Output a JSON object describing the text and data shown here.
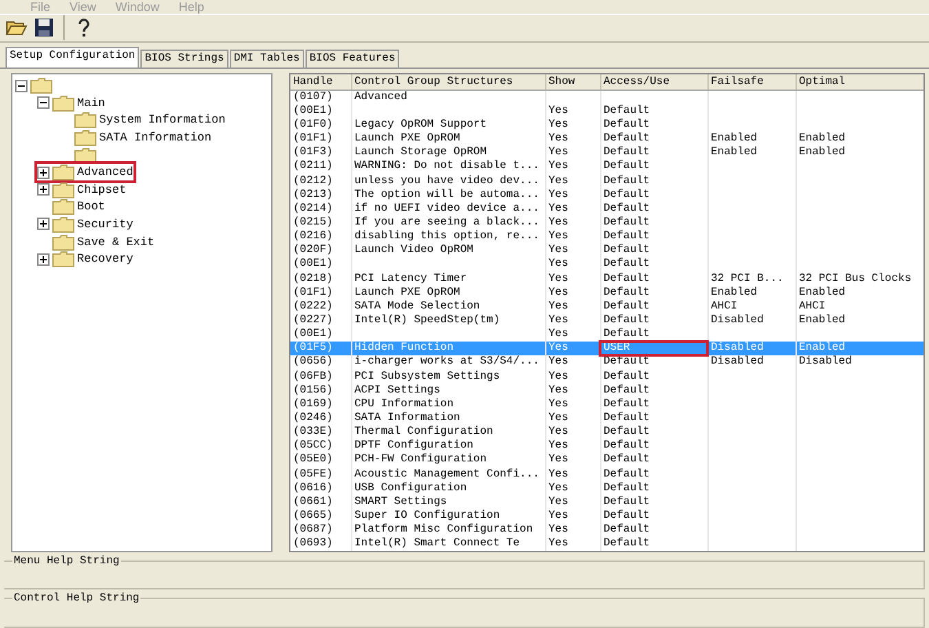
{
  "menu": [
    "File",
    "View",
    "Window",
    "Help"
  ],
  "tabs": [
    {
      "label": "Setup Configuration",
      "selected": true
    },
    {
      "label": "BIOS Strings",
      "selected": false
    },
    {
      "label": "DMI Tables",
      "selected": false
    },
    {
      "label": "BIOS Features",
      "selected": false
    }
  ],
  "tree": [
    {
      "kind": "branch",
      "expanded": true,
      "marked": false,
      "children": [
        {
          "kind": "branch",
          "label": "Main",
          "expanded": true,
          "marked": false,
          "children": [
            {
              "kind": "leaf",
              "label": "System Information",
              "marked": false
            },
            {
              "kind": "leaf",
              "label": "SATA Information",
              "marked": false
            },
            {
              "kind": "leaf",
              "marked": false
            }
          ]
        },
        {
          "kind": "branch",
          "label": "Advanced",
          "expanded": false,
          "marked": true
        },
        {
          "kind": "branch",
          "label": "Chipset",
          "expanded": false,
          "marked": false
        },
        {
          "kind": "leaf",
          "label": "Boot",
          "marked": false
        },
        {
          "kind": "branch",
          "label": "Security",
          "expanded": false,
          "marked": false
        },
        {
          "kind": "leaf",
          "label": "Save & Exit",
          "marked": false
        },
        {
          "kind": "branch",
          "label": "Recovery",
          "expanded": false,
          "marked": false
        }
      ]
    }
  ],
  "table": {
    "columns": [
      "Handle",
      "Control Group Structures",
      "Show",
      "Access/Use",
      "Failsafe",
      "Optimal"
    ],
    "rows": [
      {
        "handle": "(0107)",
        "structure": "Advanced",
        "selected": false,
        "access_marked": false
      },
      {
        "handle": "(00E1)",
        "show": "Yes",
        "access": "Default",
        "selected": false,
        "access_marked": false
      },
      {
        "handle": "(01F0)",
        "structure": "Legacy OpROM Support",
        "show": "Yes",
        "access": "Default",
        "selected": false,
        "access_marked": false
      },
      {
        "handle": "(01F1)",
        "structure": "Launch PXE OpROM",
        "show": "Yes",
        "access": "Default",
        "failsafe": "Enabled",
        "optimal": "Enabled",
        "selected": false,
        "access_marked": false
      },
      {
        "handle": "(01F3)",
        "structure": "Launch Storage OpROM",
        "show": "Yes",
        "access": "Default",
        "failsafe": "Enabled",
        "optimal": "Enabled",
        "selected": false,
        "access_marked": false
      },
      {
        "handle": "(0211)",
        "structure": "WARNING: Do not disable t...",
        "show": "Yes",
        "access": "Default",
        "selected": false,
        "access_marked": false
      },
      {
        "handle": "(0212)",
        "structure": "unless you have video dev...",
        "show": "Yes",
        "access": "Default",
        "selected": false,
        "access_marked": false
      },
      {
        "handle": "(0213)",
        "structure": "The option will be automa...",
        "show": "Yes",
        "access": "Default",
        "selected": false,
        "access_marked": false
      },
      {
        "handle": "(0214)",
        "structure": "if no UEFI video device a...",
        "show": "Yes",
        "access": "Default",
        "selected": false,
        "access_marked": false
      },
      {
        "handle": "(0215)",
        "structure": "If you are seeing a black...",
        "show": "Yes",
        "access": "Default",
        "selected": false,
        "access_marked": false
      },
      {
        "handle": "(0216)",
        "structure": "disabling this option, re...",
        "show": "Yes",
        "access": "Default",
        "selected": false,
        "access_marked": false
      },
      {
        "handle": "(020F)",
        "structure": "Launch Video OpROM",
        "show": "Yes",
        "access": "Default",
        "selected": false,
        "access_marked": false
      },
      {
        "handle": "(00E1)",
        "show": "Yes",
        "access": "Default",
        "selected": false,
        "access_marked": false
      },
      {
        "handle": "(0218)",
        "structure": "PCI Latency Timer",
        "show": "Yes",
        "access": "Default",
        "failsafe": "32 PCI B...",
        "optimal": "32 PCI Bus Clocks",
        "selected": false,
        "access_marked": false
      },
      {
        "handle": "(01F1)",
        "structure": "Launch PXE OpROM",
        "show": "Yes",
        "access": "Default",
        "failsafe": "Enabled",
        "optimal": "Enabled",
        "selected": false,
        "access_marked": false
      },
      {
        "handle": "(0222)",
        "structure": "SATA Mode Selection",
        "show": "Yes",
        "access": "Default",
        "failsafe": "AHCI",
        "optimal": "AHCI",
        "selected": false,
        "access_marked": false
      },
      {
        "handle": "(0227)",
        "structure": "Intel(R) SpeedStep(tm)",
        "show": "Yes",
        "access": "Default",
        "failsafe": "Disabled",
        "optimal": "Enabled",
        "selected": false,
        "access_marked": false
      },
      {
        "handle": "(00E1)",
        "show": "Yes",
        "access": "Default",
        "selected": false,
        "access_marked": false
      },
      {
        "handle": "(01F5)",
        "structure": "Hidden Function",
        "show": "Yes",
        "access": "USER",
        "failsafe": "Disabled",
        "optimal": "Enabled",
        "selected": true,
        "access_marked": true
      },
      {
        "handle": "(0656)",
        "structure": "i-charger works at S3/S4/...",
        "show": "Yes",
        "access": "Default",
        "failsafe": "Disabled",
        "optimal": "Disabled",
        "selected": false,
        "access_marked": false
      },
      {
        "handle": "(06FB)",
        "structure": "PCI Subsystem Settings",
        "show": "Yes",
        "access": "Default",
        "selected": false,
        "access_marked": false
      },
      {
        "handle": "(0156)",
        "structure": "ACPI Settings",
        "show": "Yes",
        "access": "Default",
        "selected": false,
        "access_marked": false
      },
      {
        "handle": "(0169)",
        "structure": "CPU Information",
        "show": "Yes",
        "access": "Default",
        "selected": false,
        "access_marked": false
      },
      {
        "handle": "(0246)",
        "structure": "SATA Information",
        "show": "Yes",
        "access": "Default",
        "selected": false,
        "access_marked": false
      },
      {
        "handle": "(033E)",
        "structure": "Thermal Configuration",
        "show": "Yes",
        "access": "Default",
        "selected": false,
        "access_marked": false
      },
      {
        "handle": "(05CC)",
        "structure": "DPTF Configuration",
        "show": "Yes",
        "access": "Default",
        "selected": false,
        "access_marked": false
      },
      {
        "handle": "(05E0)",
        "structure": "PCH-FW Configuration",
        "show": "Yes",
        "access": "Default",
        "selected": false,
        "access_marked": false
      },
      {
        "handle": "(05FE)",
        "structure": "Acoustic Management Confi...",
        "show": "Yes",
        "access": "Default",
        "selected": false,
        "access_marked": false
      },
      {
        "handle": "(0616)",
        "structure": "USB Configuration",
        "show": "Yes",
        "access": "Default",
        "selected": false,
        "access_marked": false
      },
      {
        "handle": "(0661)",
        "structure": "SMART Settings",
        "show": "Yes",
        "access": "Default",
        "selected": false,
        "access_marked": false
      },
      {
        "handle": "(0665)",
        "structure": "Super IO Configuration",
        "show": "Yes",
        "access": "Default",
        "selected": false,
        "access_marked": false
      },
      {
        "handle": "(0687)",
        "structure": "Platform Misc Configuration",
        "show": "Yes",
        "access": "Default",
        "selected": false,
        "access_marked": false
      },
      {
        "handle": "(0693)",
        "structure": "Intel(R) Smart Connect Te",
        "show": "Yes",
        "access": "Default",
        "selected": false,
        "access_marked": false
      }
    ]
  },
  "help_groups": [
    "Menu Help String",
    "Control Help String"
  ]
}
